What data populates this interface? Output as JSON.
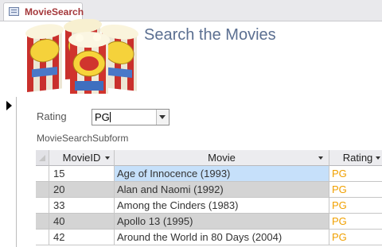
{
  "tab": {
    "label": "MovieSearch",
    "icon": "form-icon"
  },
  "header": {
    "title": "Search the Movies",
    "logo_icon": "popcorn-boxes-icon"
  },
  "filter": {
    "label": "Rating",
    "value": "PG"
  },
  "subform": {
    "label": "MovieSearchSubform"
  },
  "grid": {
    "columns": [
      "MovieID",
      "Movie",
      "Rating"
    ],
    "rows": [
      {
        "id": "15",
        "movie": "Age of Innocence (1993)",
        "rating": "PG"
      },
      {
        "id": "20",
        "movie": "Alan and Naomi (1992)",
        "rating": "PG"
      },
      {
        "id": "33",
        "movie": "Among the Cinders (1983)",
        "rating": "PG"
      },
      {
        "id": "40",
        "movie": "Apollo 13 (1995)",
        "rating": "PG"
      },
      {
        "id": "42",
        "movie": "Around the World in 80 Days (2004)",
        "rating": "PG"
      }
    ]
  },
  "colors": {
    "tab_text": "#a4373a",
    "title": "#5b6f91",
    "rating_text": "#f0a000",
    "selected_cell": "#c6e0fa",
    "alt_row": "#d4d4d4"
  }
}
